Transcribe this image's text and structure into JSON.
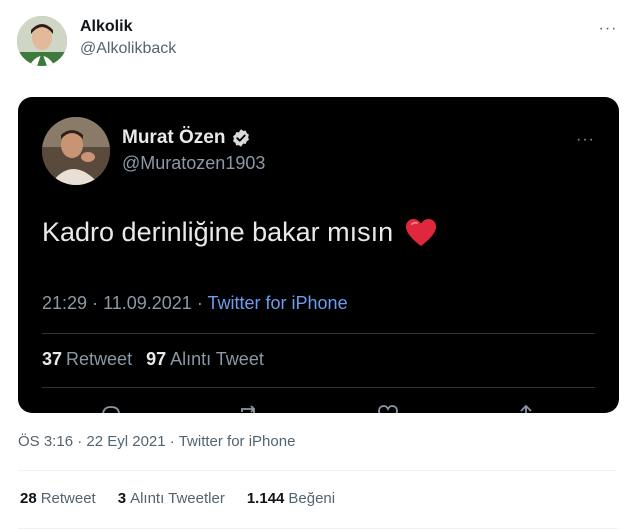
{
  "author": {
    "display_name": "Alkolik",
    "handle": "@Alkolikback",
    "avatar_icon": "profile-photo"
  },
  "more_icon": "···",
  "embedded_tweet": {
    "display_name": "Murat Özen",
    "handle": "@Muratozen1903",
    "verified_icon": "verified-badge-icon",
    "text": "Kadro derinliğine bakar mısın",
    "emoji": "❤️",
    "time": "21:29",
    "date": "11.09.2021",
    "source": "Twitter for iPhone",
    "retweets": "37",
    "retweets_label": "Retweet",
    "quotes": "97",
    "quotes_label": "Alıntı Tweet"
  },
  "tweet_meta": {
    "time": "ÖS 3:16",
    "date": "22 Eyl 2021",
    "source": "Twitter for iPhone"
  },
  "stats": {
    "retweets": "28",
    "retweets_label": "Retweet",
    "quotes": "3",
    "quotes_label": "Alıntı Tweetler",
    "likes": "1.144",
    "likes_label": "Beğeni"
  },
  "colors": {
    "link_blue": "#6b9df0",
    "verified": "#d9d9d9"
  }
}
